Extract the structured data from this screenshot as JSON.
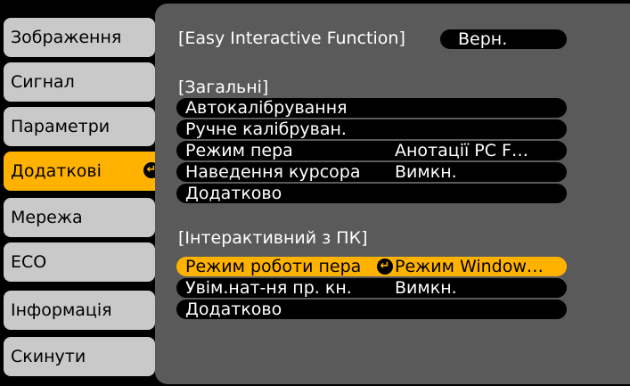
{
  "sidebar": {
    "items": [
      {
        "label": "Зображення"
      },
      {
        "label": "Сигнал"
      },
      {
        "label": "Параметри"
      },
      {
        "label": "Додаткові"
      },
      {
        "label": "Мережа"
      },
      {
        "label": "ECO"
      },
      {
        "label": "Інформація"
      },
      {
        "label": "Скинути"
      }
    ],
    "active_index": 3
  },
  "panel": {
    "top": {
      "label": "[Easy Interactive Function]",
      "button": "Верн."
    },
    "general": {
      "heading": "[Загальні]",
      "rows": [
        {
          "label": "Автокалібрування",
          "value": ""
        },
        {
          "label": "Ручне калібруван.",
          "value": ""
        },
        {
          "label": "Режим пера",
          "value": "Анотації PC F…"
        },
        {
          "label": "Наведення курсора",
          "value": "Вимкн."
        },
        {
          "label": "Додатково",
          "value": ""
        }
      ]
    },
    "interactive": {
      "heading": "[Інтерактивний з ПК]",
      "rows": [
        {
          "label": "Режим роботи пера",
          "value": "Режим Window…"
        },
        {
          "label": "Увім.нат-ня пр. кн.",
          "value": "Вимкн."
        },
        {
          "label": "Додатково",
          "value": ""
        }
      ],
      "selected_index": 0
    }
  },
  "colors": {
    "accent": "#ffb300",
    "tab_bg": "#c9c9c9",
    "panel_bg": "#5a5a5a",
    "frame_bg": "#000000"
  }
}
